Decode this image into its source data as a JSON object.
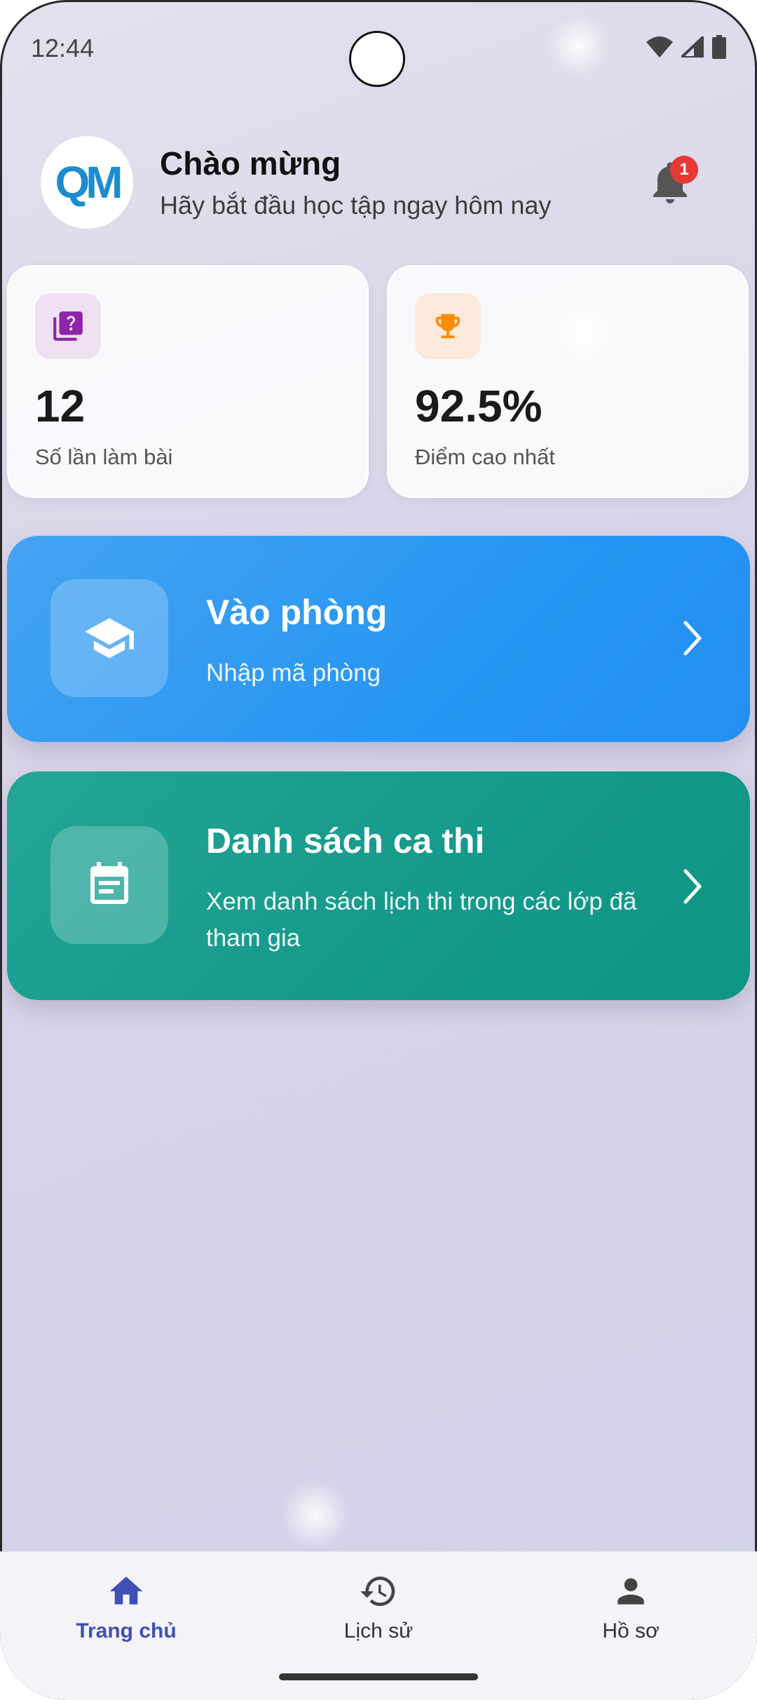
{
  "status_bar": {
    "time": "12:44"
  },
  "header": {
    "logo_text": "QM",
    "title": "Chào mừng",
    "subtitle": "Hãy bắt đầu học tập ngay hôm nay",
    "notification_count": "1"
  },
  "stats": [
    {
      "value": "12",
      "label": "Số lần làm bài",
      "icon": "quiz-icon",
      "color": "#8e24aa"
    },
    {
      "value": "92.5%",
      "label": "Điểm cao nhất",
      "icon": "trophy-icon",
      "color": "#fb8c00"
    }
  ],
  "actions": [
    {
      "title": "Vào phòng",
      "subtitle": "Nhập mã phòng",
      "icon": "graduation-cap-icon",
      "color": "#2b95f0"
    },
    {
      "title": "Danh sách ca thi",
      "subtitle": "Xem danh sách lịch thi trong các lớp đã tham gia",
      "icon": "calendar-icon",
      "color": "#14998a"
    }
  ],
  "bottom_nav": [
    {
      "label": "Trang chủ",
      "icon": "home-icon",
      "active": true
    },
    {
      "label": "Lịch sử",
      "icon": "history-icon",
      "active": false
    },
    {
      "label": "Hồ sơ",
      "icon": "person-icon",
      "active": false
    }
  ],
  "colors": {
    "accent": "#3f51b5",
    "badge": "#e53935"
  }
}
